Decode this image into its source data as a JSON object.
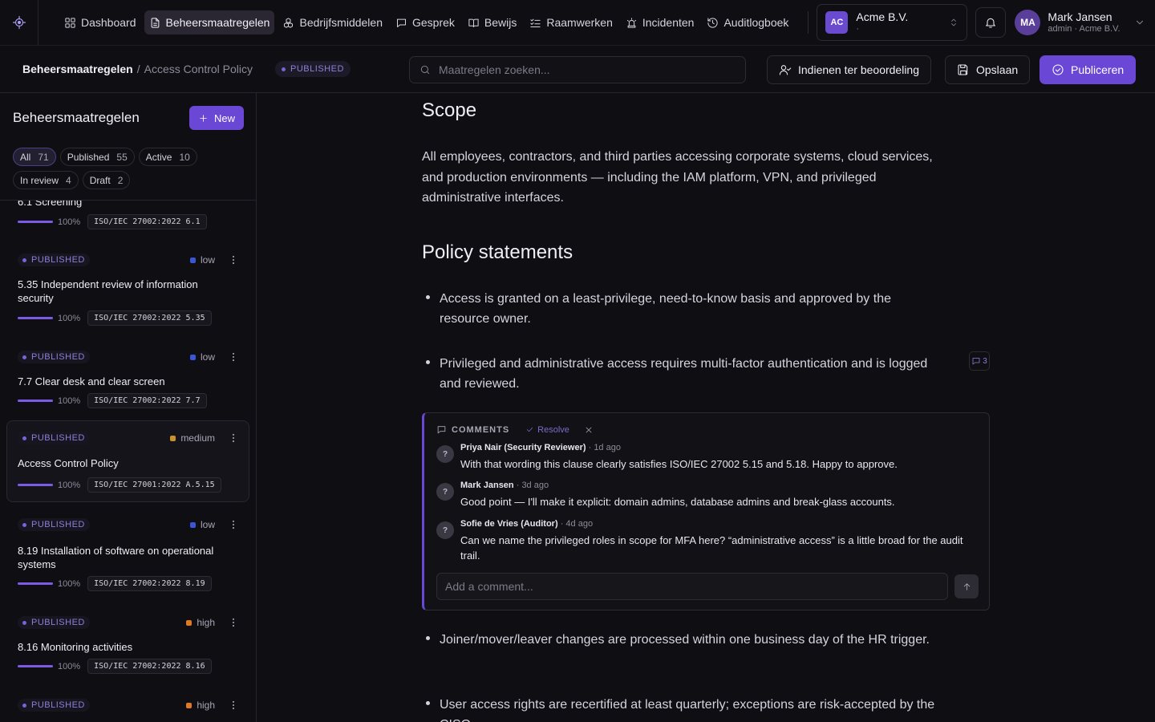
{
  "nav": {
    "items": [
      {
        "label": "Dashboard",
        "icon": "dashboard-icon"
      },
      {
        "label": "Beheersmaatregelen",
        "icon": "document-icon",
        "active": true
      },
      {
        "label": "Bedrijfsmiddelen",
        "icon": "assets-icon"
      },
      {
        "label": "Gesprek",
        "icon": "chat-icon"
      },
      {
        "label": "Bewijs",
        "icon": "book-icon"
      },
      {
        "label": "Raamwerken",
        "icon": "checklist-icon"
      },
      {
        "label": "Incidenten",
        "icon": "siren-icon"
      },
      {
        "label": "Auditlogboek",
        "icon": "history-icon"
      }
    ]
  },
  "org": {
    "initials": "AC",
    "name": "Acme B.V.",
    "sub": "·"
  },
  "user": {
    "initials": "MA",
    "name": "Mark Jansen",
    "sub": "admin · Acme B.V."
  },
  "breadcrumb": {
    "root": "Beheersmaatregelen",
    "sep": "/",
    "current": "Access Control Policy"
  },
  "status_badge": "PUBLISHED",
  "search": {
    "placeholder": "Maatregelen zoeken..."
  },
  "actions": {
    "submit": "Indienen ter beoordeling",
    "save": "Opslaan",
    "publish": "Publiceren"
  },
  "sidebar": {
    "title": "Beheersmaatregelen",
    "new_label": "New",
    "filters": [
      {
        "label": "All",
        "count": "71",
        "active": true
      },
      {
        "label": "Published",
        "count": "55"
      },
      {
        "label": "Active",
        "count": "10"
      },
      {
        "label": "In review",
        "count": "4"
      },
      {
        "label": "Draft",
        "count": "2"
      }
    ],
    "items": [
      {
        "status": "",
        "severity": "",
        "title": "6.1 Screening",
        "progress": "100%",
        "tag": "ISO/IEC 27002:2022 6.1"
      },
      {
        "status": "PUBLISHED",
        "severity": "low",
        "title": "5.35 Independent review of information security",
        "progress": "100%",
        "tag": "ISO/IEC 27002:2022 5.35"
      },
      {
        "status": "PUBLISHED",
        "severity": "low",
        "title": "7.7 Clear desk and clear screen",
        "progress": "100%",
        "tag": "ISO/IEC 27002:2022 7.7"
      },
      {
        "status": "PUBLISHED",
        "severity": "medium",
        "title": "Access Control Policy",
        "progress": "100%",
        "tag": "ISO/IEC 27001:2022 A.5.15"
      },
      {
        "status": "PUBLISHED",
        "severity": "low",
        "title": "8.19 Installation of software on operational systems",
        "progress": "100%",
        "tag": "ISO/IEC 27002:2022 8.19"
      },
      {
        "status": "PUBLISHED",
        "severity": "high",
        "title": "8.16 Monitoring activities",
        "progress": "100%",
        "tag": "ISO/IEC 27002:2022 8.16"
      },
      {
        "status": "PUBLISHED",
        "severity": "high",
        "title": "",
        "progress": "",
        "tag": ""
      }
    ]
  },
  "colors": {
    "low": "#3b55d6",
    "medium": "#c9922a",
    "high": "#e07a22",
    "accent": "#6a47d4"
  },
  "document": {
    "scope_heading": "Scope",
    "scope_text": "All employees, contractors, and third parties accessing corporate systems, cloud services, and production environments — including the IAM platform, VPN, and privileged administrative interfaces.",
    "statements_heading": "Policy statements",
    "statements": [
      "Access is granted on a least-privilege, need-to-know basis and approved by the resource owner.",
      "Privileged and administrative access requires multi-factor authentication and is logged and reviewed.",
      "Joiner/mover/leaver changes are processed within one business day of the HR trigger.",
      "User access rights are recertified at least quarterly; exceptions are risk-accepted by the CISO."
    ],
    "comment_count": "3"
  },
  "comments": {
    "heading": "COMMENTS",
    "resolve_label": "Resolve",
    "input_placeholder": "Add a comment...",
    "items": [
      {
        "avatar": "?",
        "author": "Priya Nair (Security Reviewer)",
        "time": "· 1d ago",
        "text": "With that wording this clause clearly satisfies ISO/IEC 27002 5.15 and 5.18. Happy to approve."
      },
      {
        "avatar": "?",
        "author": "Mark Jansen",
        "time": "· 3d ago",
        "text": "Good point — I'll make it explicit: domain admins, database admins and break-glass accounts."
      },
      {
        "avatar": "?",
        "author": "Sofie de Vries (Auditor)",
        "time": "· 4d ago",
        "text": "Can we name the privileged roles in scope for MFA here? “administrative access” is a little broad for the audit trail."
      }
    ]
  }
}
